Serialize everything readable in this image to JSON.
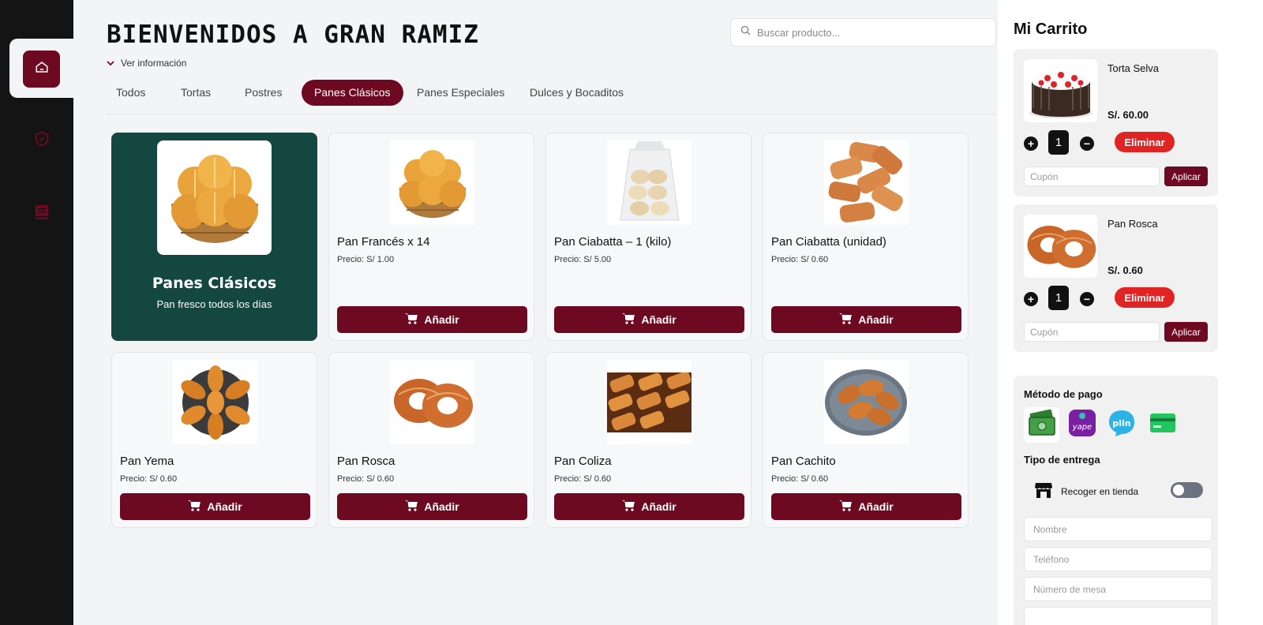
{
  "sidebar": {
    "items": [
      {
        "icon": "home-icon",
        "active": true
      },
      {
        "icon": "shield-icon",
        "active": false
      },
      {
        "icon": "book-icon",
        "active": false
      }
    ]
  },
  "header": {
    "welcome": "BIENVENIDOS A GRAN RAMIZ",
    "info_toggle": "Ver información",
    "search_placeholder": "Buscar producto..."
  },
  "tabs": [
    {
      "label": "Todos",
      "active": false
    },
    {
      "label": "Tortas",
      "active": false
    },
    {
      "label": "Postres",
      "active": false
    },
    {
      "label": "Panes Clásicos",
      "active": true
    },
    {
      "label": "Panes Especiales",
      "active": false
    },
    {
      "label": "Dulces y Bocaditos",
      "active": false
    }
  ],
  "category": {
    "title": "Panes Clásicos",
    "subtitle": "Pan fresco todos los días",
    "image": "bread-basket"
  },
  "add_label": "Añadir",
  "products": [
    {
      "name": "Pan Francés x 14",
      "price": "Precio: S/ 1.00",
      "image": "bread-basket"
    },
    {
      "name": "Pan Ciabatta – 1 (kilo)",
      "price": "Precio: S/ 5.00",
      "image": "bread-bag"
    },
    {
      "name": "Pan Ciabatta (unidad)",
      "price": "Precio: S/ 0.60",
      "image": "ciabatta-pile"
    },
    {
      "name": "Pan Yema",
      "price": "Precio: S/ 0.60",
      "image": "yema-rolls"
    },
    {
      "name": "Pan Rosca",
      "price": "Precio: S/ 0.60",
      "image": "rosca-rings"
    },
    {
      "name": "Pan Coliza",
      "price": "Precio: S/ 0.60",
      "image": "coliza-rows"
    },
    {
      "name": "Pan Cachito",
      "price": "Precio: S/ 0.60",
      "image": "cachito-plate"
    }
  ],
  "cart": {
    "title": "Mi Carrito",
    "items": [
      {
        "name": "Torta Selva",
        "price": "S/. 60.00",
        "qty": "1",
        "image": "cake"
      },
      {
        "name": "Pan Rosca",
        "price": "S/. 0.60",
        "qty": "1",
        "image": "rosca-rings"
      }
    ],
    "qty_plus": "+",
    "qty_minus": "−",
    "delete_label": "Eliminar",
    "coupon_placeholder": "Cupón",
    "apply_label": "Aplicar",
    "payment_title": "Método de pago",
    "payment_methods": [
      {
        "icon": "cash-icon",
        "selected": true,
        "color": "#3a8a2f"
      },
      {
        "icon": "yape-icon",
        "label": "yape",
        "selected": false,
        "color": "#7b1fa2"
      },
      {
        "icon": "plin-icon",
        "label": "plin",
        "selected": false,
        "color": "#2bb3e6"
      },
      {
        "icon": "card-icon",
        "selected": false,
        "color": "#22c55e"
      }
    ],
    "delivery_title": "Tipo de entrega",
    "pickup_label": "Recoger en tienda",
    "pickup_enabled": false,
    "fields": {
      "name_placeholder": "Nombre",
      "phone_placeholder": "Teléfono",
      "table_placeholder": "Número de mesa"
    }
  },
  "colors": {
    "brand": "#6d0a22",
    "category_bg": "#154741",
    "danger": "#e02424",
    "sidebar_bg": "#141414"
  }
}
